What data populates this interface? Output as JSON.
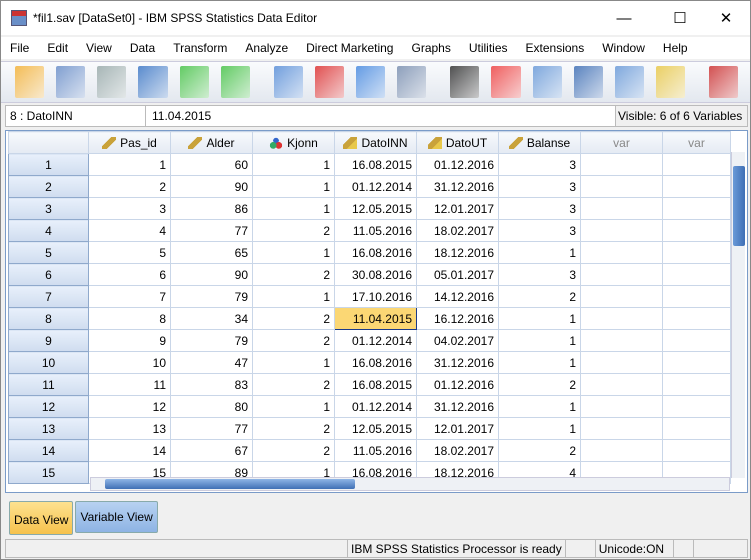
{
  "window": {
    "title": "*fil1.sav [DataSet0] - IBM SPSS Statistics Data Editor",
    "minimize": "—",
    "maximize": "☐",
    "close": "✕"
  },
  "menu": [
    "File",
    "Edit",
    "View",
    "Data",
    "Transform",
    "Analyze",
    "Direct Marketing",
    "Graphs",
    "Utilities",
    "Extensions",
    "Window",
    "Help"
  ],
  "toolbar": [
    "open-icon",
    "save-icon",
    "print-icon",
    "recall-dialog-icon",
    "undo-icon",
    "redo-icon",
    "goto-case-icon",
    "goto-variable-icon",
    "variables-icon",
    "run-descriptives-icon",
    "find-icon",
    "insert-cases-icon",
    "insert-variable-icon",
    "split-file-icon",
    "weight-cases-icon",
    "select-cases-icon",
    "value-labels-icon"
  ],
  "editor": {
    "cell_name": "8 : DatoINN",
    "cell_value": "11.04.2015",
    "visible": "Visible: 6 of 6 Variables"
  },
  "columns": [
    {
      "name": "Pas_id",
      "icon": "scale-icon"
    },
    {
      "name": "Alder",
      "icon": "scale-icon"
    },
    {
      "name": "Kjonn",
      "icon": "nominal-icon"
    },
    {
      "name": "DatoINN",
      "icon": "date-icon"
    },
    {
      "name": "DatoUT",
      "icon": "date-icon"
    },
    {
      "name": "Balanse",
      "icon": "scale-icon"
    },
    {
      "name": "var",
      "icon": ""
    },
    {
      "name": "var",
      "icon": ""
    }
  ],
  "rows": [
    [
      "1",
      "1",
      "60",
      "1",
      "16.08.2015",
      "01.12.2016",
      "3"
    ],
    [
      "2",
      "2",
      "90",
      "1",
      "01.12.2014",
      "31.12.2016",
      "3"
    ],
    [
      "3",
      "3",
      "86",
      "1",
      "12.05.2015",
      "12.01.2017",
      "3"
    ],
    [
      "4",
      "4",
      "77",
      "2",
      "11.05.2016",
      "18.02.2017",
      "3"
    ],
    [
      "5",
      "5",
      "65",
      "1",
      "16.08.2016",
      "18.12.2016",
      "1"
    ],
    [
      "6",
      "6",
      "90",
      "2",
      "30.08.2016",
      "05.01.2017",
      "3"
    ],
    [
      "7",
      "7",
      "79",
      "1",
      "17.10.2016",
      "14.12.2016",
      "2"
    ],
    [
      "8",
      "8",
      "34",
      "2",
      "11.04.2015",
      "16.12.2016",
      "1"
    ],
    [
      "9",
      "9",
      "79",
      "2",
      "01.12.2014",
      "04.02.2017",
      "1"
    ],
    [
      "10",
      "10",
      "47",
      "1",
      "16.08.2016",
      "31.12.2016",
      "1"
    ],
    [
      "11",
      "11",
      "83",
      "2",
      "16.08.2015",
      "01.12.2016",
      "2"
    ],
    [
      "12",
      "12",
      "80",
      "1",
      "01.12.2014",
      "31.12.2016",
      "1"
    ],
    [
      "13",
      "13",
      "77",
      "2",
      "12.05.2015",
      "12.01.2017",
      "1"
    ],
    [
      "14",
      "14",
      "67",
      "2",
      "11.05.2016",
      "18.02.2017",
      "2"
    ],
    [
      "15",
      "15",
      "89",
      "1",
      "16.08.2016",
      "18.12.2016",
      "4"
    ]
  ],
  "selected": {
    "row": 8,
    "column": "DatoINN"
  },
  "tabs": [
    {
      "label": "Data View",
      "active": true
    },
    {
      "label": "Variable View",
      "active": false
    }
  ],
  "status": {
    "processor": "IBM SPSS Statistics Processor is ready",
    "unicode": "Unicode:ON"
  },
  "colors": {
    "selected_cell": "#fbd774",
    "active_tab": "#f6c24c",
    "inactive_tab": "#8eb4e4"
  }
}
